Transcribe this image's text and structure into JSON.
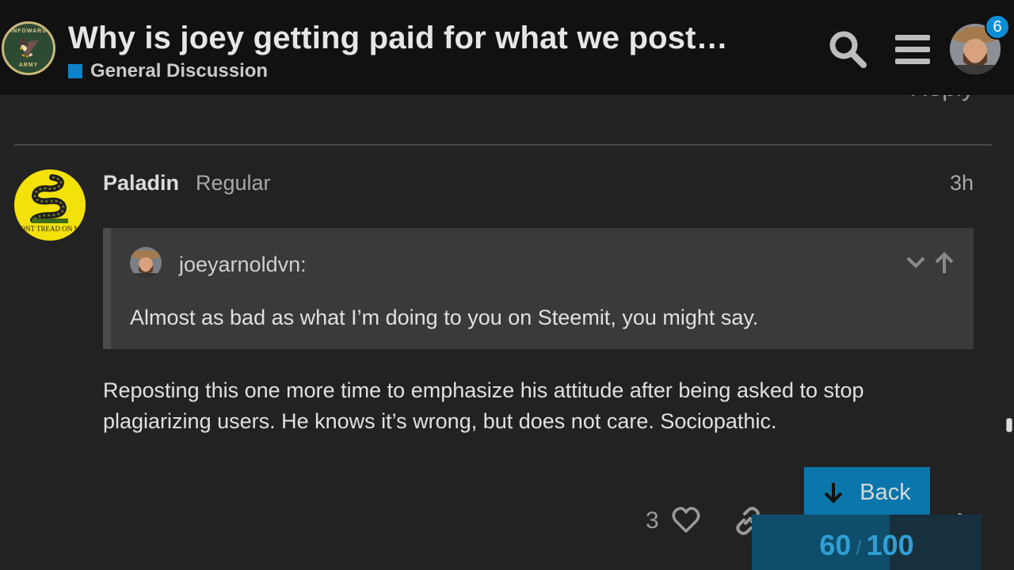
{
  "header": {
    "topic_title": "Why is joey getting paid for what we post…",
    "category": {
      "name": "General Discussion",
      "color": "#0d83c9"
    },
    "notification_count": "6",
    "logo_text_top": "INFOWARS",
    "logo_text_bottom": "ARMY"
  },
  "previous_post": {
    "reply_label": "Reply"
  },
  "post": {
    "username": "Paladin",
    "user_title": "Regular",
    "time": "3h",
    "avatar_motto": "DONT TREAD ON ME",
    "quote": {
      "author": "joeyarnoldvn:",
      "text": "Almost as bad as what I’m doing to you on Steemit, you might say."
    },
    "body_lines": [
      "Reposting this one more time to emphasize his attitude after being asked to stop",
      "plagiarizing users. He knows it’s wrong, but does not care. Sociopathic."
    ],
    "like_count": "3"
  },
  "timeline": {
    "back_label": "Back",
    "current": "60",
    "separator": "/",
    "total": "100",
    "progress_fraction": 0.6
  },
  "colors": {
    "background": "#222222",
    "header": "#111111",
    "accent": "#0a76ab"
  }
}
